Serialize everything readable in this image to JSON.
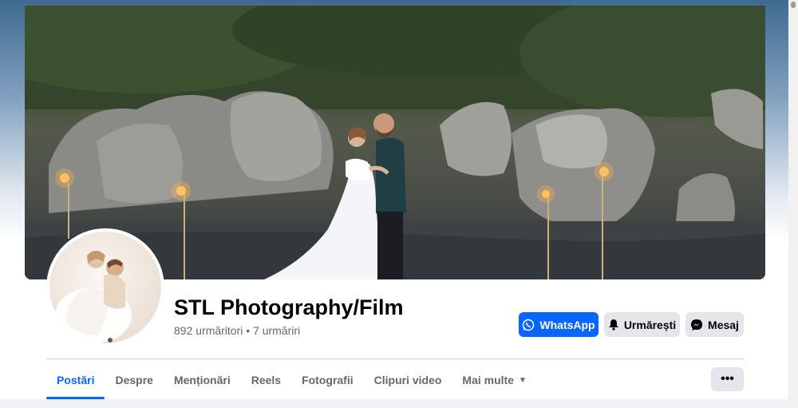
{
  "page": {
    "name": "STL Photography/Film",
    "followers": "892 urmăritori",
    "separator": "•",
    "following": "7 urmăriri"
  },
  "actions": {
    "whatsapp_label": "WhatsApp",
    "follow_label": "Urmărești",
    "message_label": "Mesaj",
    "whatsapp_color": "#0866ff"
  },
  "tabs": [
    {
      "label": "Postări",
      "active": true
    },
    {
      "label": "Despre",
      "active": false
    },
    {
      "label": "Menționări",
      "active": false
    },
    {
      "label": "Reels",
      "active": false
    },
    {
      "label": "Fotografii",
      "active": false
    },
    {
      "label": "Clipuri video",
      "active": false
    },
    {
      "label": "Mai multe",
      "active": false
    }
  ],
  "more_button": {
    "label": "•••"
  },
  "icons": {
    "whatsapp": "whatsapp-icon",
    "follow": "bell-icon",
    "message": "messenger-icon",
    "dropdown": "caret-down-icon"
  }
}
